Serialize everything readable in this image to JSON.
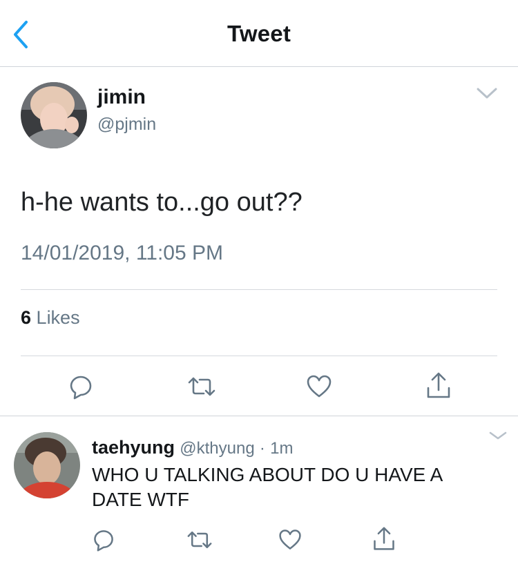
{
  "nav": {
    "title": "Tweet",
    "back_icon": "chevron-left-icon"
  },
  "tweet": {
    "display_name": "jimin",
    "handle": "@pjmin",
    "text": "h-he wants to...go out??",
    "timestamp": "14/01/2019, 11:05 PM",
    "likes_count": "6",
    "likes_label": "Likes"
  },
  "reply": {
    "display_name": "taehyung",
    "handle": "@kthyung",
    "separator": "·",
    "age": "1m",
    "text": "WHO U TALKING ABOUT DO U HAVE A DATE WTF"
  },
  "colors": {
    "accent": "#1da1f2",
    "muted": "#657786",
    "divider": "#d5d9dd",
    "text": "#14171a"
  }
}
